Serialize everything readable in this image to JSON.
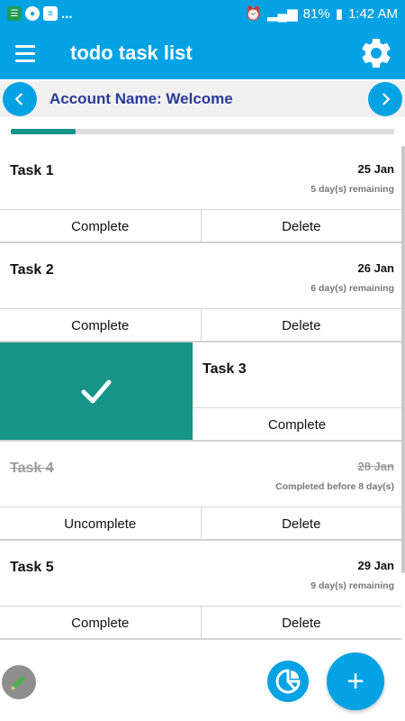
{
  "status_bar": {
    "dots": "...",
    "battery": "81%",
    "time": "1:42 AM"
  },
  "app_bar": {
    "title": "todo task list",
    "menu_icon": "hamburger-menu-icon",
    "settings_icon": "gear-icon"
  },
  "account": {
    "label": "Account Name: Welcome"
  },
  "progress": {
    "fraction": 0.17
  },
  "tasks": [
    {
      "title": "Task 1",
      "date": "25 Jan",
      "remaining": "5 day(s) remaining",
      "actions": [
        "Complete",
        "Delete"
      ],
      "completed": false
    },
    {
      "title": "Task 2",
      "date": "26 Jan",
      "remaining": "6 day(s) remaining",
      "actions": [
        "Complete",
        "Delete"
      ],
      "completed": false
    },
    {
      "title": "Task 3",
      "actions": [
        "Complete"
      ],
      "completed": false,
      "swiped": true
    },
    {
      "title": "Task 4",
      "date": "28 Jan",
      "remaining": "Completed before 8 day(s)",
      "actions": [
        "Uncomplete",
        "Delete"
      ],
      "completed": true
    },
    {
      "title": "Task 5",
      "date": "29 Jan",
      "remaining": "9 day(s) remaining",
      "actions": [
        "Complete",
        "Delete"
      ],
      "completed": false
    }
  ],
  "colors": {
    "primary": "#03a2e4",
    "accent": "#159487",
    "account_text": "#2b3a9a"
  }
}
